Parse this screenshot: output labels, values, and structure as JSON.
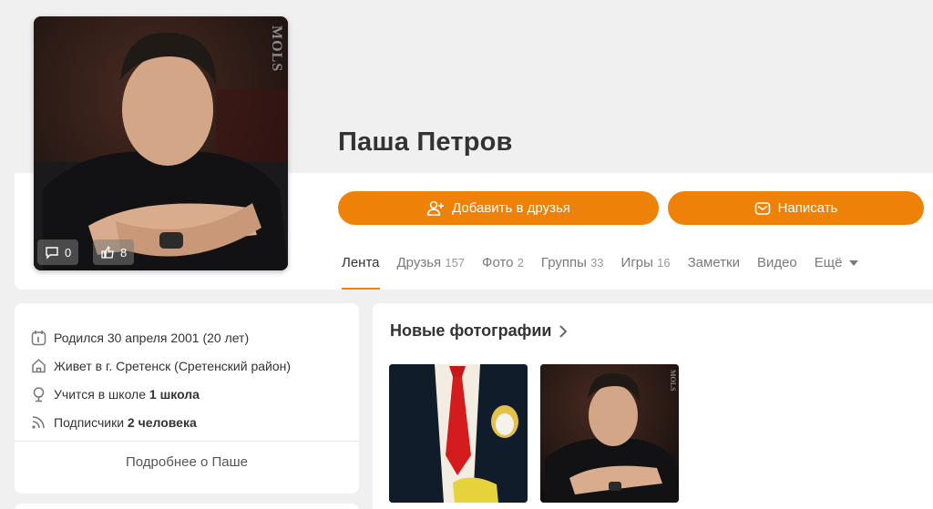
{
  "profile": {
    "name": "Паша Петров",
    "avatar_watermark": "MOLS",
    "avatar_stats": {
      "comments": "0",
      "likes": "8"
    }
  },
  "actions": {
    "add_friend": "Добавить в друзья",
    "message": "Написать"
  },
  "tabs": [
    {
      "label": "Лента",
      "count": "",
      "active": true
    },
    {
      "label": "Друзья",
      "count": "157"
    },
    {
      "label": "Фото",
      "count": "2"
    },
    {
      "label": "Группы",
      "count": "33"
    },
    {
      "label": "Игры",
      "count": "16"
    },
    {
      "label": "Заметки",
      "count": ""
    },
    {
      "label": "Видео",
      "count": ""
    },
    {
      "label": "Ещё",
      "count": ""
    }
  ],
  "info": {
    "born": "Родился 30 апреля 2001 (20 лет)",
    "lives": "Живет в г. Сретенск (Сретенский район)",
    "school_prefix": "Учится в школе",
    "school_name": "1 школа",
    "subs_prefix": "Подписчики",
    "subs_count": "2 человека",
    "more": "Подробнее о Паше"
  },
  "photos": {
    "title": "Новые фотографии"
  },
  "colors": {
    "accent": "#ee8208",
    "background": "#f0f0f0"
  }
}
